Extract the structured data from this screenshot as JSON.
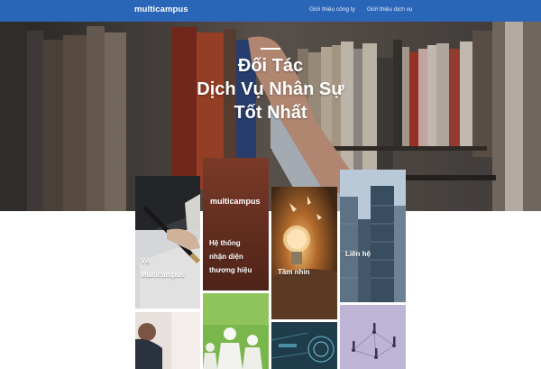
{
  "header": {
    "logo_text": "multicampus",
    "nav": [
      {
        "label": "Giới thiệu công ty"
      },
      {
        "label": "Giới thiệu dịch vụ"
      }
    ]
  },
  "hero": {
    "title_lines": [
      "Đối Tác",
      "Dịch Vụ Nhân Sự",
      "Tốt Nhất"
    ]
  },
  "tiles": {
    "about": {
      "label_lines": [
        "Về",
        "Multicampus"
      ]
    },
    "brand": {
      "logo_text": "multicampus",
      "label_lines": [
        "Hệ thống",
        "nhận diện",
        "thương hiệu"
      ]
    },
    "vision": {
      "label": "Tầm nhìn"
    },
    "contact": {
      "label": "Liên hệ"
    }
  },
  "colors": {
    "nav_bg": "#2a66b8",
    "brand_tile": "#6b3222"
  }
}
